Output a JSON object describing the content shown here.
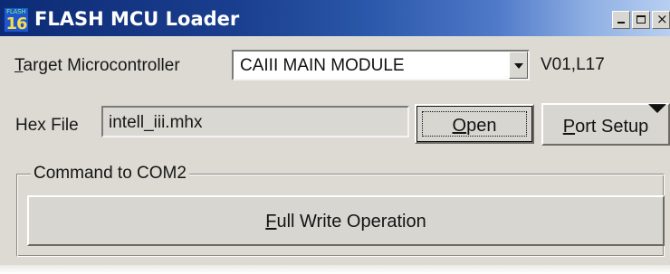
{
  "window": {
    "title": "FLASH MCU Loader",
    "controls": {
      "minimize": "_",
      "maximize": "□",
      "close": "×"
    },
    "icon": {
      "name": "flash-loader-app-icon",
      "top_text": "FLASH",
      "bottom_text": "16"
    }
  },
  "main": {
    "target_label": "Target Microcontroller",
    "target_value": "CAIII MAIN MODULE",
    "version": "V01,L17",
    "hex_label": "Hex File",
    "hex_value": "intell_iii.mhx",
    "open_label": "Open",
    "port_setup_label": "Port Setup"
  },
  "command": {
    "group_title": "Command  to  COM2",
    "write_label": "Full Write Operation"
  },
  "colors": {
    "window_background": "#dcdad3",
    "titlebar_left": "#0d2b75",
    "titlebar_right": "#b8cff2",
    "field_white": "#ffffff"
  }
}
